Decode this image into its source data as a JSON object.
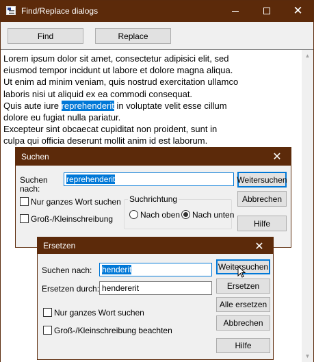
{
  "window": {
    "title": "Find/Replace dialogs"
  },
  "toolbar": {
    "find_label": "Find",
    "replace_label": "Replace"
  },
  "text": {
    "lines": [
      [
        "Lorem ipsum dolor sit amet, consectetur adipisici elit, sed",
        "",
        ""
      ],
      [
        "eiusmod tempor incidunt ut labore et dolore magna aliqua.",
        "",
        ""
      ],
      [
        "Ut enim ad minim veniam, quis nostrud exercitation ullamco",
        "",
        ""
      ],
      [
        "laboris nisi ut aliquid ex ea commodi consequat.",
        "",
        ""
      ],
      [
        "Quis aute iure ",
        "reprehenderit",
        " in voluptate velit esse cillum"
      ],
      [
        "dolore eu fugiat nulla pariatur.",
        "",
        ""
      ],
      [
        "Excepteur sint obcaecat cupiditat non proident, sunt in",
        "",
        ""
      ],
      [
        "culpa qui officia deserunt mollit anim id est laborum.",
        "",
        ""
      ]
    ]
  },
  "find_dialog": {
    "title": "Suchen",
    "search_label": "Suchen\nnach:",
    "search_value": "reprehenderit",
    "whole_word_label": "Nur ganzes Wort suchen",
    "match_case_label": "Groß-/Kleinschreibung",
    "direction_label": "Suchrichtung",
    "up_label": "Nach oben",
    "down_label": "Nach unten",
    "direction_selected": "down",
    "find_next_label": "Weitersuchen",
    "cancel_label": "Abbrechen",
    "help_label": "Hilfe"
  },
  "replace_dialog": {
    "title": "Ersetzen",
    "search_label": "Suchen nach:",
    "search_value": "henderit",
    "replace_label": "Ersetzen durch:",
    "replace_value": "hendererit",
    "whole_word_label": "Nur ganzes Wort suchen",
    "match_case_label": "Groß-/Kleinschreibung beachten",
    "find_next_label": "Weitersuchen",
    "replace_button_label": "Ersetzen",
    "replace_all_label": "Alle ersetzen",
    "cancel_label": "Abbrechen",
    "help_label": "Hilfe"
  },
  "colors": {
    "titlebar": "#5c2a0a",
    "selection": "#0078d7"
  }
}
